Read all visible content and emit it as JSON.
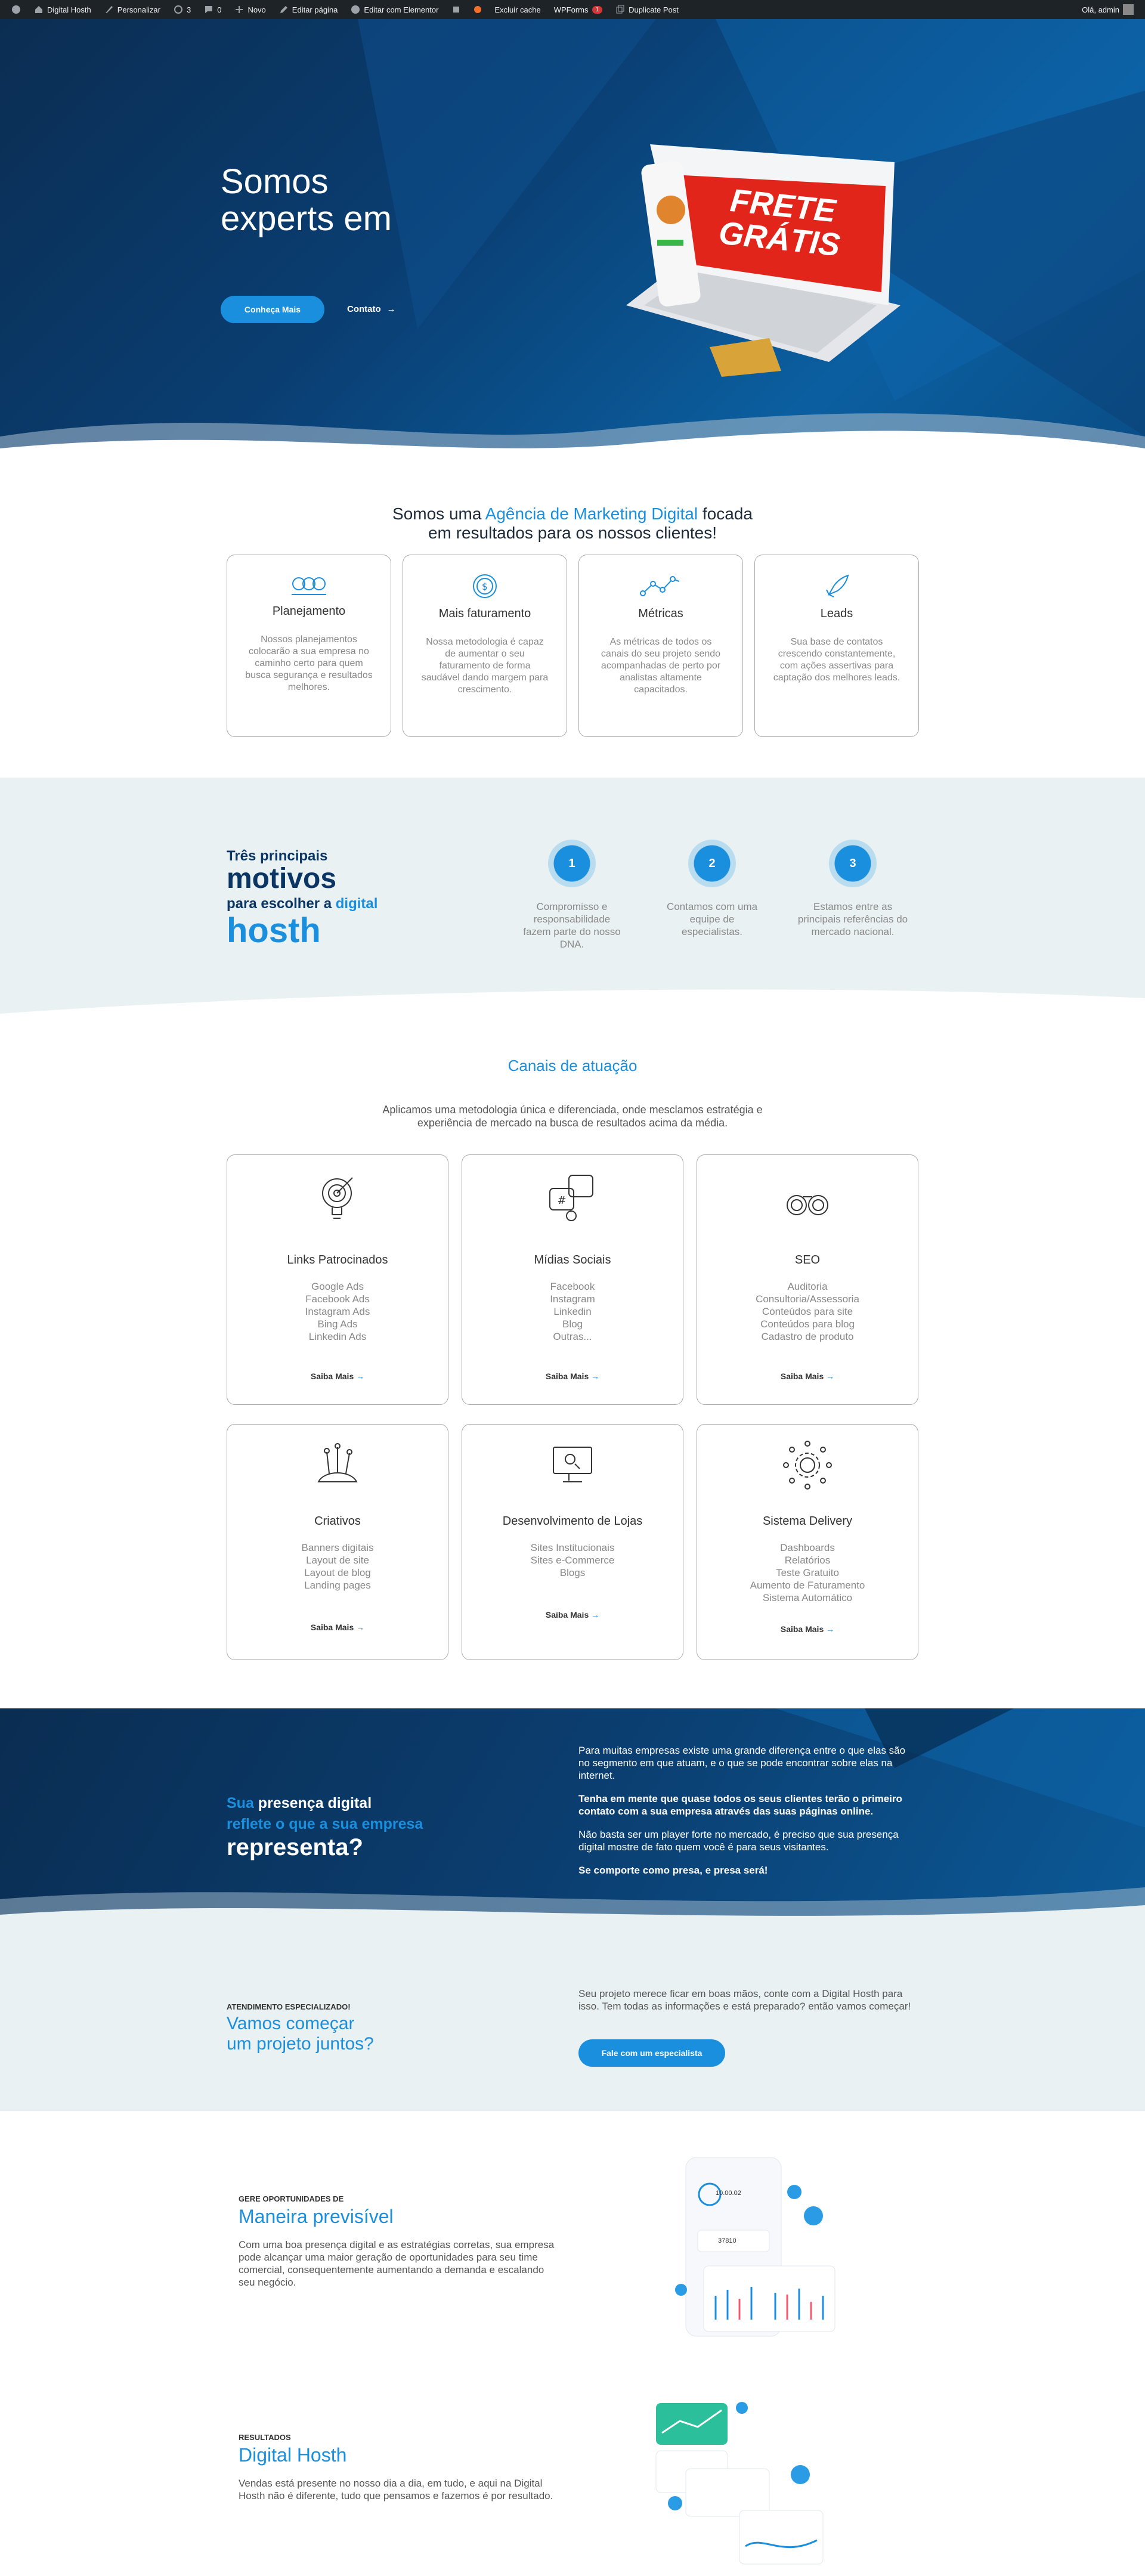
{
  "adminbar": {
    "site": "Digital Hosth",
    "customize": "Personalizar",
    "updates": "3",
    "comments": "0",
    "new": "Novo",
    "edit_page": "Editar página",
    "elementor": "Editar com Elementor",
    "clear_cache": "Excluir cache",
    "wpforms": "WPForms",
    "wpforms_badge": "1",
    "duplicate": "Duplicate Post",
    "greeting": "Olá, admin"
  },
  "hero": {
    "title_line1": "Somos",
    "title_line2": "experts em",
    "cta_primary": "Conheça Mais",
    "cta_secondary": "Contato",
    "arrow": "→",
    "promo_line1": "FRETE",
    "promo_line2": "GRÁTIS"
  },
  "intro": {
    "line1_a": "Somos uma ",
    "line1_highlight": "Agência de Marketing Digital",
    "line1_b": " focada",
    "line2": "em resultados para os nossos clientes!",
    "cards": [
      {
        "icon": "people-icon",
        "title": "Planejamento",
        "text": "Nossos planejamentos colocarão a sua empresa no caminho certo para quem busca segurança e resultados melhores."
      },
      {
        "icon": "dollar-coin-icon",
        "title": "Mais faturamento",
        "text": "Nossa metodologia é capaz de aumentar o seu faturamento de forma saudável dando margem para crescimento."
      },
      {
        "icon": "line-graph-icon",
        "title": "Métricas",
        "text": "As métricas de todos os canais do seu projeto sendo acompanhadas de perto por analistas altamente capacitados."
      },
      {
        "icon": "rocket-icon",
        "title": "Leads",
        "text": "Sua base de contatos crescendo constantemente, com ações assertivas para captação dos melhores leads."
      }
    ]
  },
  "reasons": {
    "small1": "Três principais",
    "big1": "motivos",
    "small2_a": "para escolher a ",
    "small2_b": "digital",
    "big2": "hosth",
    "items": [
      {
        "n": "1",
        "text": "Compromisso e responsabilidade fazem parte do nosso DNA."
      },
      {
        "n": "2",
        "text": "Contamos com uma equipe de especialistas."
      },
      {
        "n": "3",
        "text": "Estamos entre as principais referências do mercado nacional."
      }
    ]
  },
  "channels": {
    "title": "Canais de atuação",
    "subtitle_1": "Aplicamos uma metodologia única e diferenciada, onde mesclamos estratégia e",
    "subtitle_2": "experiência de mercado na busca de resultados acima da média.",
    "more": "Saiba Mais",
    "arrow": "→",
    "cards": [
      {
        "icon": "target-bulb-icon",
        "title": "Links Patrocinados",
        "items": [
          "Google Ads",
          "Facebook Ads",
          "Instagram Ads",
          "Bing Ads",
          "Linkedin Ads"
        ]
      },
      {
        "icon": "social-media-icon",
        "title": "Mídias Sociais",
        "items": [
          "Facebook",
          "Instagram",
          "Linkedin",
          "Blog",
          "Outras..."
        ]
      },
      {
        "icon": "binoculars-icon",
        "title": "SEO",
        "items": [
          "Auditoria",
          "Consultoria/Assessoria",
          "Conteúdos para site",
          "Conteúdos para blog",
          "Cadastro de produto"
        ]
      },
      {
        "icon": "creative-brushes-icon",
        "title": "Criativos",
        "items": [
          "Banners digitais",
          "Layout de site",
          "Layout de blog",
          "Landing pages"
        ]
      },
      {
        "icon": "store-monitor-icon",
        "title": "Desenvolvimento de Lojas",
        "items": [
          "Sites Institucionais",
          "Sites e-Commerce",
          "Blogs"
        ]
      },
      {
        "icon": "gear-network-icon",
        "title": "Sistema Delivery",
        "items": [
          "Dashboards",
          "Relatórios",
          "Teste Gratuito",
          "Aumento de Faturamento",
          "Sistema Automático"
        ]
      }
    ]
  },
  "presence": {
    "l1_a": "Sua",
    "l1_b": " presença digital",
    "l2": "reflete o que a sua empresa",
    "l3": "representa?",
    "p1": "Para muitas empresas existe uma grande diferença entre o que elas são no segmento em que atuam, e o que se pode encontrar sobre elas na internet.",
    "p2": "Tenha em mente que quase todos os seus clientes terão o primeiro contato com a sua empresa através das suas páginas online.",
    "p3": "Não basta ser um player forte no mercado, é preciso que sua presença digital mostre de fato quem você é para seus visitantes.",
    "p4": "Se comporte como presa, e presa será!"
  },
  "start": {
    "kicker": "ATENDIMENTO ESPECIALIZADO!",
    "title_1": "Vamos começar",
    "title_2": "um projeto juntos?",
    "text": "Seu projeto merece ficar em boas mãos, conte com a Digital Hosth para isso. Tem todas as informações e está preparado? então vamos começar!",
    "cta": "Fale com um especialista"
  },
  "predictable": {
    "kicker": "GERE OPORTUNIDADES DE",
    "title": "Maneira previsível",
    "text": "Com uma boa presença digital e as estratégias corretas, sua empresa pode alcançar uma maior geração de oportunidades para seu time comercial, consequentemente aumentando a demanda e escalando seu negócio.",
    "phone_value": "10.00.02",
    "phone_value2": "37810"
  },
  "results": {
    "kicker": "RESULTADOS",
    "title": "Digital Hosth",
    "text": "Vendas está presente no nosso dia a dia, em tudo, e aqui na Digital Hosth não é diferente, tudo que pensamos e fazemos é por resultado."
  },
  "colors": {
    "accent": "#1a8fdd",
    "navy": "#0b3563",
    "pale": "#e9f1f3"
  }
}
